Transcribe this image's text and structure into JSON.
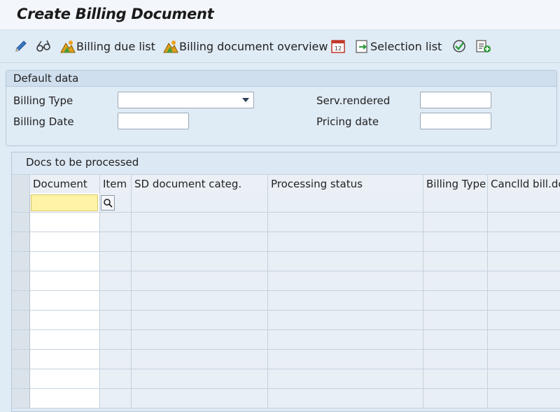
{
  "window": {
    "title": "Create Billing Document"
  },
  "toolbar": {
    "billing_due_list": "Billing due list",
    "billing_doc_overview": "Billing document overview",
    "selection_list": "Selection list"
  },
  "default_data": {
    "group_title": "Default data",
    "billing_type_label": "Billing Type",
    "billing_type_value": "",
    "billing_date_label": "Billing Date",
    "billing_date_value": "",
    "serv_rendered_label": "Serv.rendered",
    "serv_rendered_value": "",
    "pricing_date_label": "Pricing date",
    "pricing_date_value": ""
  },
  "docs": {
    "title": "Docs to be processed",
    "columns": [
      "Document",
      "Item",
      "SD document categ.",
      "Processing status",
      "Billing Type",
      "Canclld bill.dc"
    ],
    "rows": []
  },
  "colors": {
    "background": "#dfebf5",
    "focus_field": "#fff4a6",
    "header_bg": "#eaf0f6"
  }
}
